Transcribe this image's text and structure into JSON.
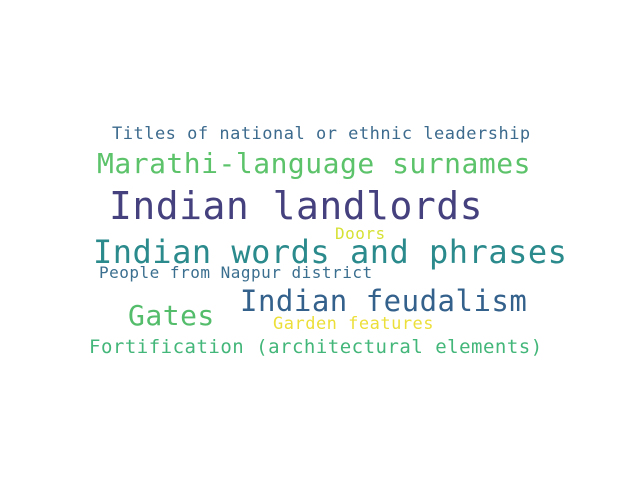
{
  "words": [
    {
      "text": "Titles of national or ethnic leadership",
      "color": "#3d6b8e"
    },
    {
      "text": "Marathi-language surnames",
      "color": "#5cc36b"
    },
    {
      "text": "Indian landlords",
      "color": "#45407e"
    },
    {
      "text": "Doors",
      "color": "#d6e135"
    },
    {
      "text": "Indian words and phrases",
      "color": "#2a8a8c"
    },
    {
      "text": "People from Nagpur district",
      "color": "#3b6f8f"
    },
    {
      "text": "Indian feudalism",
      "color": "#33618c"
    },
    {
      "text": "Gates",
      "color": "#53bd6b"
    },
    {
      "text": "Garden features",
      "color": "#ecdf39"
    },
    {
      "text": "Fortification (architectural elements)",
      "color": "#43b679"
    }
  ]
}
